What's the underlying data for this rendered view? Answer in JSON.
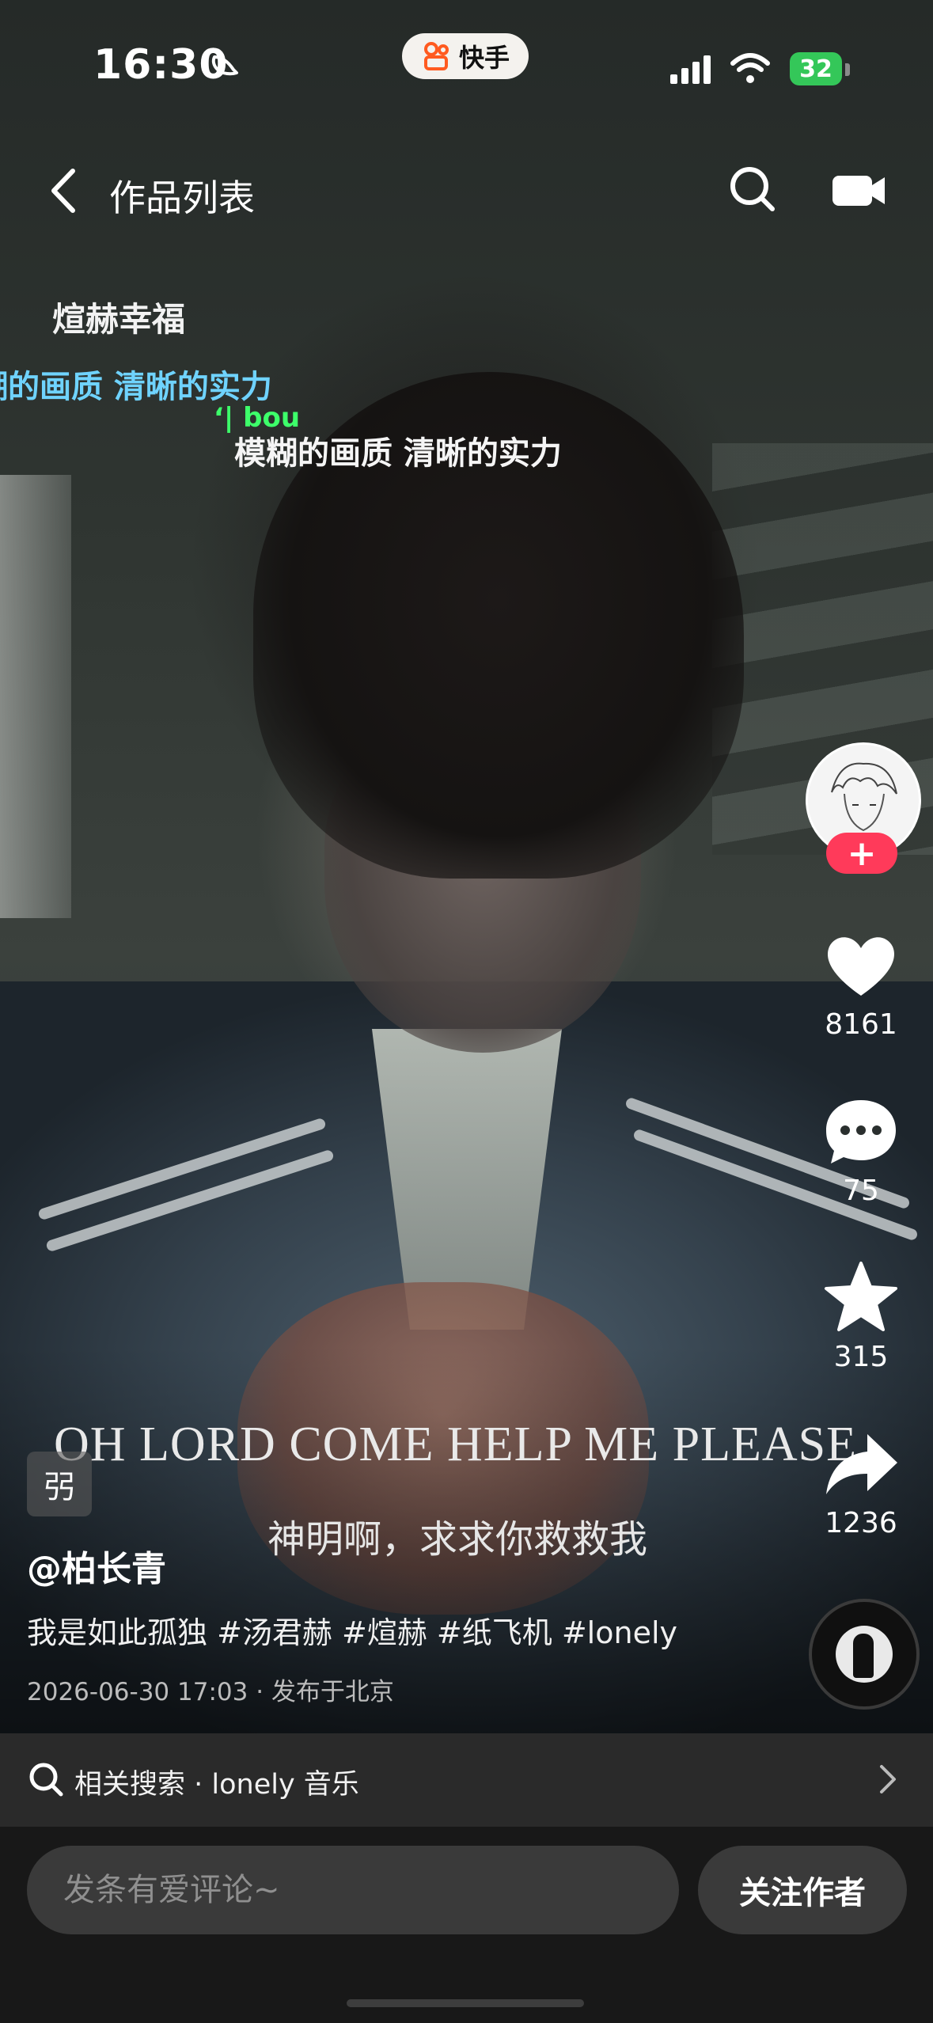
{
  "status_bar": {
    "time": "16:30",
    "app_name": "快手",
    "battery": "32"
  },
  "nav": {
    "title": "作品列表"
  },
  "overlay": {
    "uploader_tag": "煊赫幸福",
    "subtitle_cyan": "糊的画质 清晰的实力",
    "subtitle_white": "模糊的画质 清晰的实力",
    "green_mark": "‘| bou",
    "english_subtitle": "OH LORD COME HELP ME PLEASE",
    "chinese_subtitle": "神明啊，求求你救救我"
  },
  "rail": {
    "likes": "8161",
    "comments": "75",
    "favorites": "315",
    "shares": "1236"
  },
  "caption": {
    "tag_badge": "弜",
    "author": "@柏长青",
    "text": "我是如此孤独 #汤君赫 #煊赫 #纸飞机 #lonely",
    "meta": "2026-06-30 17:03 · 发布于北京"
  },
  "related_search": {
    "label": "相关搜索 · lonely 音乐"
  },
  "bottom": {
    "comment_placeholder": "发条有爱评论~",
    "follow_label": "关注作者"
  },
  "colors": {
    "follow_plus": "#ff3a5a",
    "battery": "#34c759",
    "subtitle_cyan": "#6fd3ff"
  },
  "icons": [
    "moon-icon",
    "kuaishou-logo-icon",
    "signal-icon",
    "wifi-icon",
    "back-icon",
    "search-icon",
    "camera-icon",
    "heart-icon",
    "comment-icon",
    "star-icon",
    "share-icon",
    "music-disc-icon",
    "chevron-right-icon"
  ]
}
